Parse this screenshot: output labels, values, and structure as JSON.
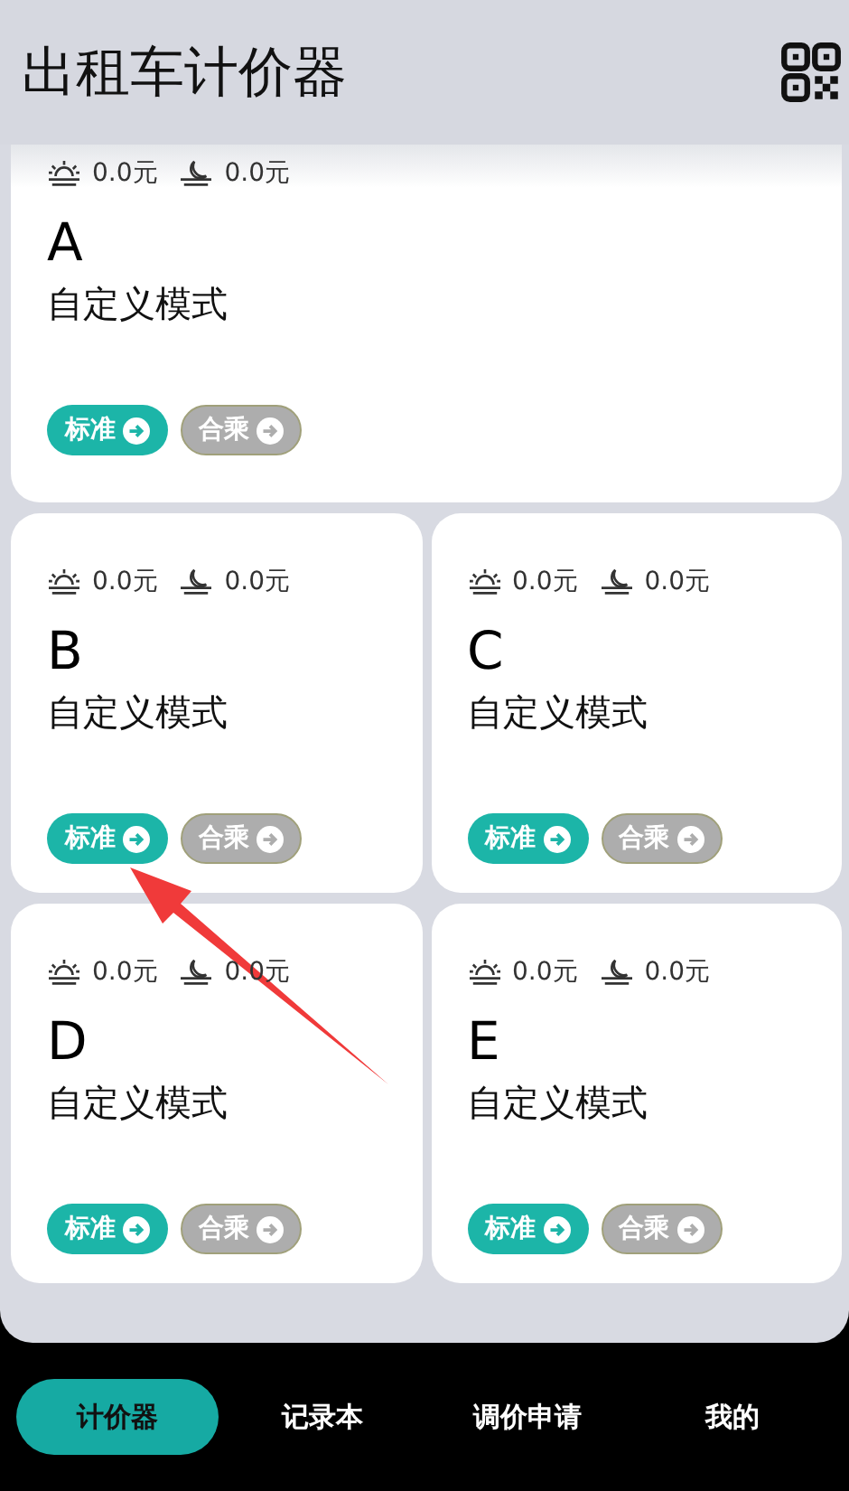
{
  "title": "出租车计价器",
  "cards": [
    {
      "letter": "A",
      "mode": "自定义模式",
      "day_fare": "0.0元",
      "night_fare": "0.0元",
      "wide": true,
      "buttons": [
        {
          "label": "标准",
          "disabled": false
        },
        {
          "label": "合乘",
          "disabled": true
        }
      ]
    },
    {
      "letter": "B",
      "mode": "自定义模式",
      "day_fare": "0.0元",
      "night_fare": "0.0元",
      "wide": false,
      "buttons": [
        {
          "label": "标准",
          "disabled": false
        },
        {
          "label": "合乘",
          "disabled": true
        }
      ]
    },
    {
      "letter": "C",
      "mode": "自定义模式",
      "day_fare": "0.0元",
      "night_fare": "0.0元",
      "wide": false,
      "buttons": [
        {
          "label": "标准",
          "disabled": false
        },
        {
          "label": "合乘",
          "disabled": true
        }
      ]
    },
    {
      "letter": "D",
      "mode": "自定义模式",
      "day_fare": "0.0元",
      "night_fare": "0.0元",
      "wide": false,
      "buttons": [
        {
          "label": "标准",
          "disabled": false
        },
        {
          "label": "合乘",
          "disabled": true
        }
      ]
    },
    {
      "letter": "E",
      "mode": "自定义模式",
      "day_fare": "0.0元",
      "night_fare": "0.0元",
      "wide": false,
      "buttons": [
        {
          "label": "标准",
          "disabled": false
        },
        {
          "label": "合乘",
          "disabled": true
        }
      ]
    }
  ],
  "nav": [
    {
      "label": "计价器",
      "selected": true
    },
    {
      "label": "记录本",
      "selected": false
    },
    {
      "label": "调价申请",
      "selected": false
    },
    {
      "label": "我的",
      "selected": false
    }
  ]
}
